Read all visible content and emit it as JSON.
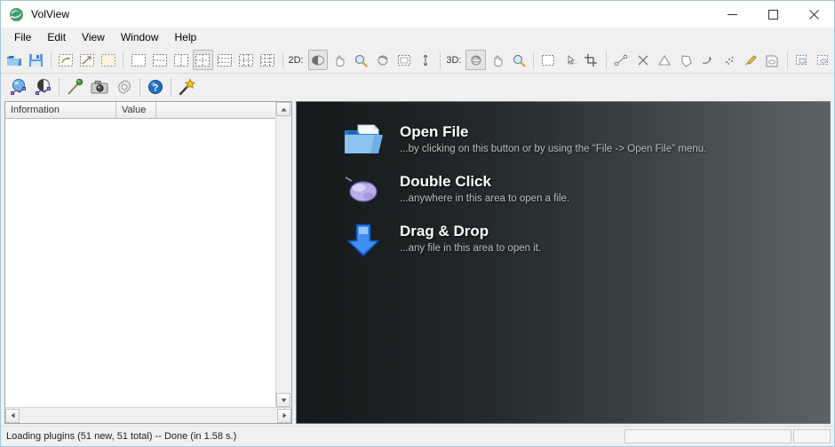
{
  "window": {
    "title": "VolView",
    "app_icon": "volview-logo-icon",
    "controls": {
      "minimize": "minimize-icon",
      "maximize": "maximize-icon",
      "close": "close-icon"
    }
  },
  "menubar": {
    "items": [
      {
        "label": "File"
      },
      {
        "label": "Edit"
      },
      {
        "label": "View"
      },
      {
        "label": "Window"
      },
      {
        "label": "Help"
      }
    ]
  },
  "toolbar": {
    "file_group": [
      {
        "name": "open-file-button",
        "icon": "open-folder-icon"
      },
      {
        "name": "save-file-button",
        "icon": "floppy-save-icon"
      }
    ],
    "view_group": [
      {
        "name": "reset-view-button",
        "icon": "reset-view-icon"
      },
      {
        "name": "fit-view-button",
        "icon": "fit-view-icon"
      },
      {
        "name": "blank-view-button",
        "icon": "blank-view-icon"
      }
    ],
    "layout_group": [
      {
        "name": "layout-single-button",
        "icon": "layout-single-icon",
        "selected": false
      },
      {
        "name": "layout-two-rows-button",
        "icon": "layout-two-rows-icon",
        "selected": false
      },
      {
        "name": "layout-two-cols-button",
        "icon": "layout-two-cols-icon",
        "selected": false
      },
      {
        "name": "layout-quad-button",
        "icon": "layout-quad-icon",
        "selected": true
      },
      {
        "name": "layout-three-rows-button",
        "icon": "layout-three-rows-icon",
        "selected": false
      },
      {
        "name": "layout-six-button",
        "icon": "layout-six-icon",
        "selected": false
      },
      {
        "name": "layout-nine-button",
        "icon": "layout-nine-icon",
        "selected": false
      }
    ],
    "mode_2d_label": "2D:",
    "tools_2d": [
      {
        "name": "window-level-2d-button",
        "icon": "window-level-icon",
        "selected": true
      },
      {
        "name": "pan-2d-button",
        "icon": "pan-hand-icon",
        "selected": false
      },
      {
        "name": "zoom-2d-button",
        "icon": "magnifier-icon",
        "selected": false
      },
      {
        "name": "rotate-2d-button",
        "icon": "rotate-icon",
        "selected": false
      },
      {
        "name": "select-2d-button",
        "icon": "marquee-select-icon",
        "selected": false
      },
      {
        "name": "slice-2d-button",
        "icon": "slice-updown-icon",
        "selected": false
      }
    ],
    "mode_3d_label": "3D:",
    "tools_3d": [
      {
        "name": "rotate-3d-button",
        "icon": "rotate-icon",
        "selected": true
      },
      {
        "name": "pan-3d-button",
        "icon": "pan-hand-icon",
        "selected": false
      },
      {
        "name": "zoom-3d-button",
        "icon": "magnifier-icon",
        "selected": false
      }
    ],
    "annotation_group": [
      {
        "name": "marquee-button",
        "icon": "marquee-select-icon"
      },
      {
        "name": "pick-point-button",
        "icon": "pick-point-icon"
      },
      {
        "name": "crop-button",
        "icon": "crop-icon"
      }
    ],
    "measure_group": [
      {
        "name": "distance-measure-button",
        "icon": "ruler-distance-icon"
      },
      {
        "name": "cross-marker-button",
        "icon": "cross-marker-icon"
      },
      {
        "name": "angle-measure-button",
        "icon": "angle-measure-icon"
      },
      {
        "name": "polygon-tool-button",
        "icon": "polygon-icon"
      },
      {
        "name": "arrow-annotation-button",
        "icon": "arrow-annotation-icon"
      },
      {
        "name": "seed-points-button",
        "icon": "seed-points-icon"
      },
      {
        "name": "paint-brush-button",
        "icon": "paint-brush-icon"
      },
      {
        "name": "stamp-label-button",
        "icon": "stamp-label-icon"
      }
    ],
    "capture_group": [
      {
        "name": "copy-view-button",
        "icon": "copy-view-icon"
      },
      {
        "name": "export-view-button",
        "icon": "export-view-icon"
      }
    ]
  },
  "toolbar2": {
    "buttons": [
      {
        "name": "volume-render-button",
        "icon": "blue-sphere-icon"
      },
      {
        "name": "surface-render-button",
        "icon": "shaded-sphere-icon"
      },
      {
        "name": "light-settings-button",
        "icon": "light-pin-icon"
      },
      {
        "name": "screenshot-button",
        "icon": "camera-icon"
      },
      {
        "name": "preferences-button",
        "icon": "gear-icon"
      },
      {
        "name": "help-button",
        "icon": "help-question-icon"
      },
      {
        "name": "wizard-button",
        "icon": "magic-wand-icon"
      }
    ]
  },
  "info_panel": {
    "columns": [
      {
        "label": "Information"
      },
      {
        "label": "Value"
      }
    ],
    "rows": [],
    "scroll": {
      "up_arrow": "scroll-up-icon",
      "down_arrow": "scroll-down-icon",
      "left_arrow": "scroll-left-icon",
      "right_arrow": "scroll-right-icon"
    }
  },
  "viewport": {
    "background_start": "#15191a",
    "background_end": "#5a6262",
    "hints": [
      {
        "icon": "open-folder-large-icon",
        "title": "Open File",
        "subtitle": "...by clicking on this button or by using the \"File -> Open File\" menu."
      },
      {
        "icon": "computer-mouse-icon",
        "title": "Double Click",
        "subtitle": "...anywhere in this area to open a file."
      },
      {
        "icon": "down-arrow-icon",
        "title": "Drag & Drop",
        "subtitle": "...any file in this area to open it."
      }
    ]
  },
  "statusbar": {
    "message": "Loading plugins (51 new, 51 total) -- Done (in 1.58 s.)",
    "progress_value": "",
    "secondary_value": ""
  }
}
